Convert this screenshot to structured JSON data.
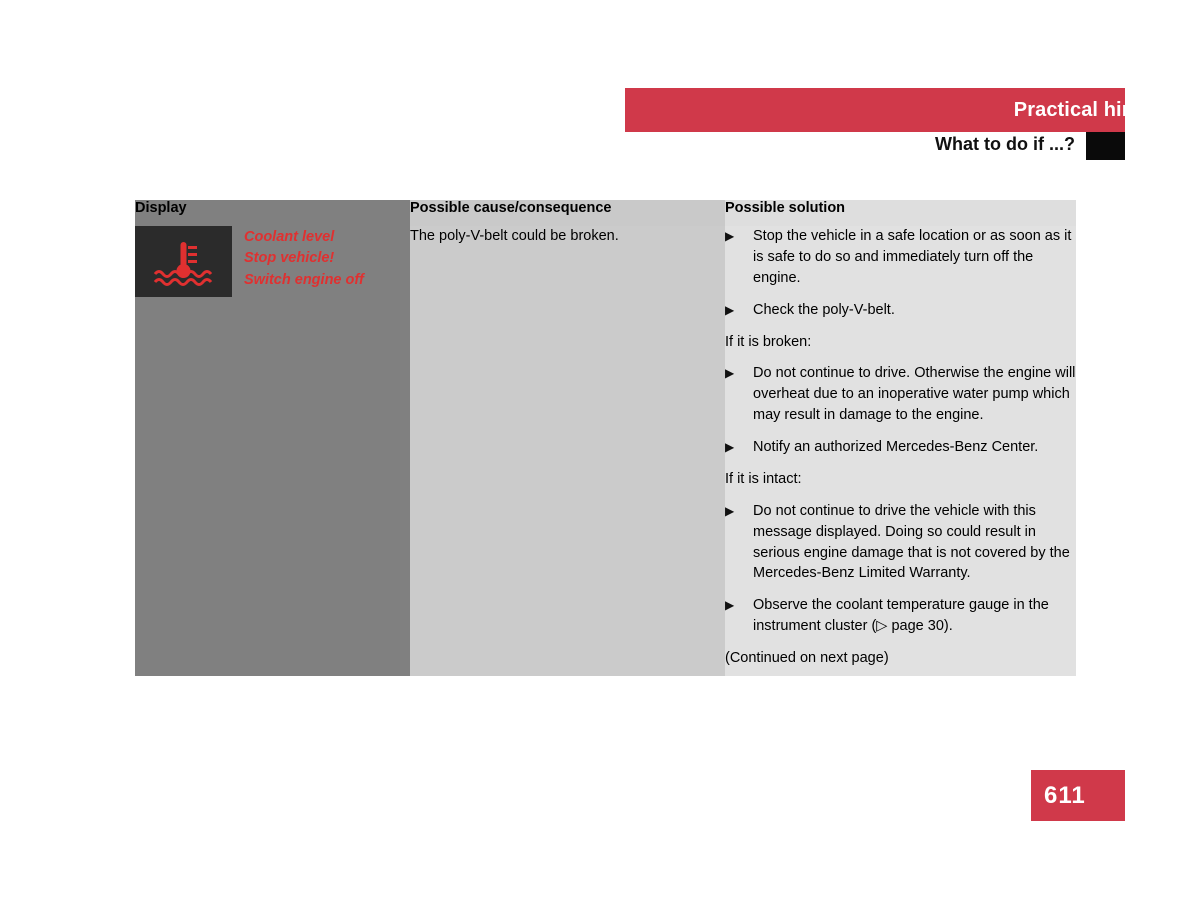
{
  "header": {
    "title": "Practical hints",
    "subtitle": "What to do if ...?",
    "bar_color": "#d0394a",
    "tab_color": "#0a0a0a"
  },
  "table": {
    "columns": [
      {
        "key": "display",
        "label": "Display"
      },
      {
        "key": "cause",
        "label": "Possible cause/consequence"
      },
      {
        "key": "solution",
        "label": "Possible solution"
      }
    ],
    "row": {
      "display": {
        "symbol_icon": "coolant-temperature-warning-icon",
        "symbol_color": "#e03030",
        "symbol_background": "#2b2b2b",
        "message_lines": [
          "Coolant level",
          "Stop vehicle!",
          "Switch engine off"
        ],
        "message_color": "#e03030"
      },
      "cause": "The poly-V-belt could be broken.",
      "solution": {
        "items": [
          {
            "type": "bullet",
            "marker": "solid-triangle-right",
            "text": "Stop the vehicle in a safe location or as soon as it is safe to do so and immediately turn off the engine."
          },
          {
            "type": "bullet",
            "marker": "solid-triangle-right",
            "text": "Check the poly-V-belt."
          },
          {
            "type": "note",
            "text": "If it is broken:"
          },
          {
            "type": "bullet",
            "marker": "solid-triangle-right",
            "text": "Do not continue to drive. Otherwise the engine will overheat due to an inoperative water pump which may result in damage to the engine."
          },
          {
            "type": "bullet",
            "marker": "solid-triangle-right",
            "text": "Notify an authorized Mercedes-Benz Center."
          },
          {
            "type": "note",
            "text": "If it is intact:"
          },
          {
            "type": "bullet",
            "marker": "solid-triangle-right",
            "text": "Do not continue to drive the vehicle with this message displayed. Doing so could result in serious engine damage that is not covered by the Mercedes-Benz Limited Warranty."
          },
          {
            "type": "bullet",
            "marker": "solid-triangle-right",
            "text": "Observe the coolant temperature gauge in the instrument cluster (▷ page 30)."
          },
          {
            "type": "footer",
            "text": "(Continued on next page)"
          }
        ]
      }
    }
  },
  "footer": {
    "page_number": "611",
    "page_badge_color": "#d0394a"
  }
}
